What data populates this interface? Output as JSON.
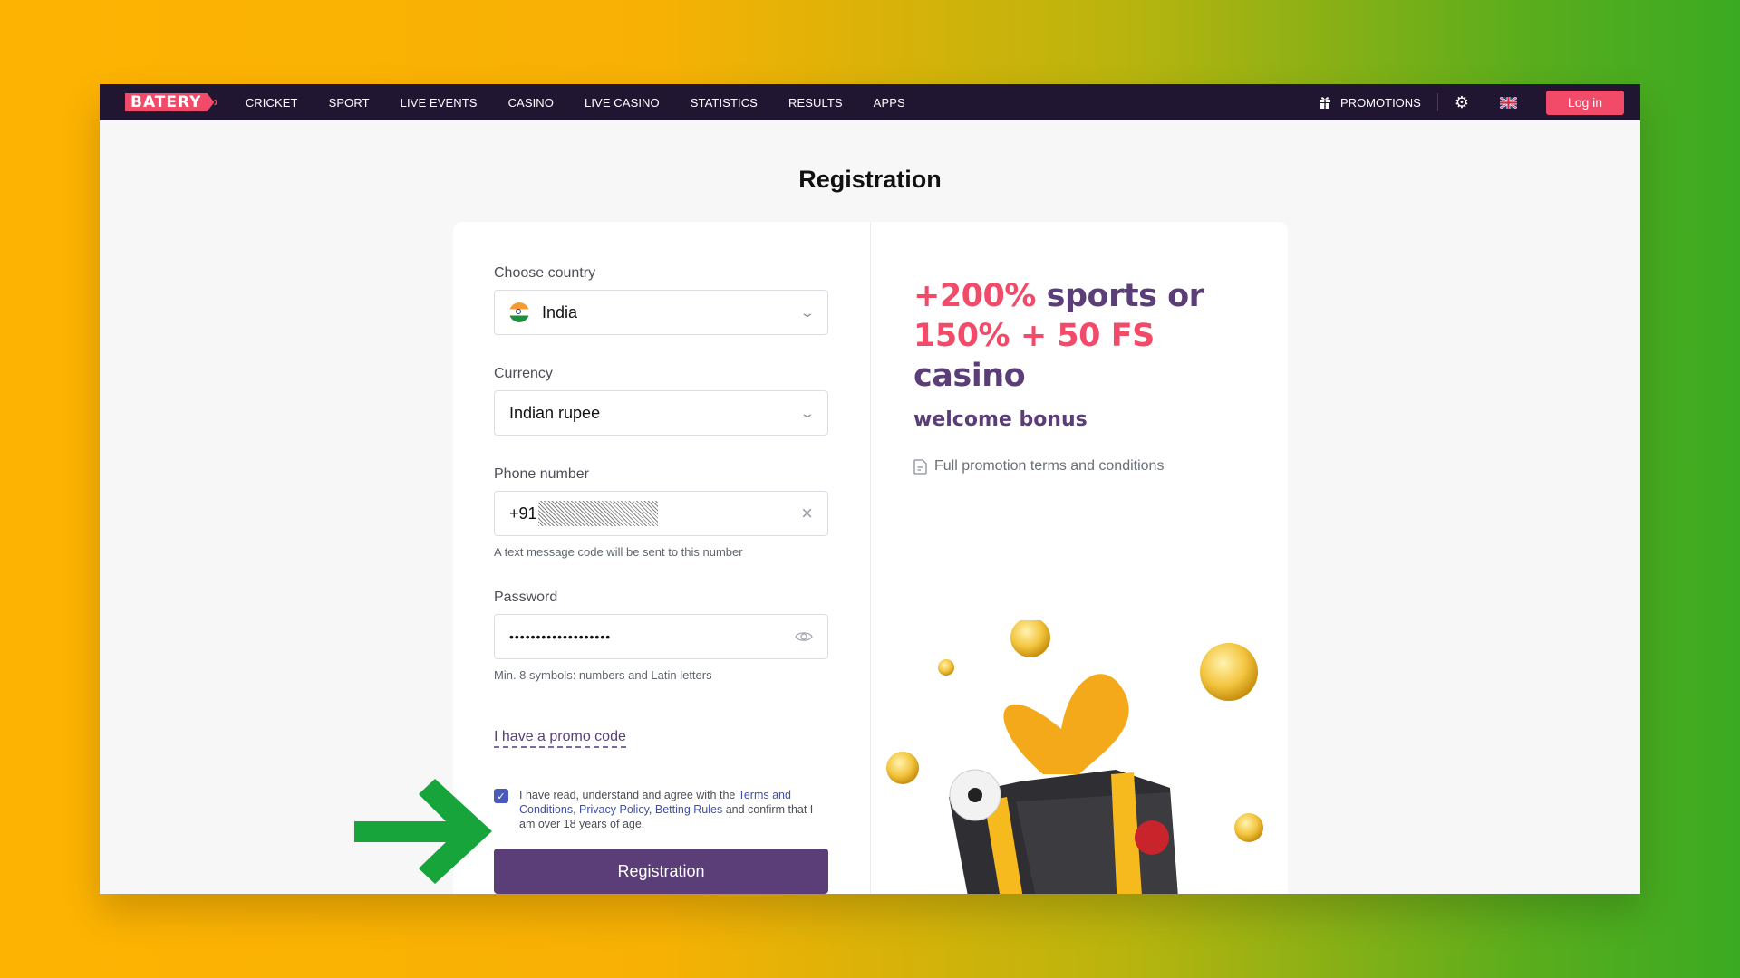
{
  "nav": {
    "logo": "BATERY",
    "links": [
      "CRICKET",
      "SPORT",
      "LIVE EVENTS",
      "CASINO",
      "LIVE CASINO",
      "STATISTICS",
      "RESULTS",
      "APPS"
    ],
    "promotions": "PROMOTIONS",
    "login": "Log in",
    "icons": {
      "promotions": "gift-icon",
      "settings": "gear-icon",
      "language": "uk-flag-icon"
    }
  },
  "page": {
    "title": "Registration"
  },
  "form": {
    "country": {
      "label": "Choose country",
      "value": "India",
      "icon": "india-flag-icon"
    },
    "currency": {
      "label": "Currency",
      "value": "Indian rupee"
    },
    "phone": {
      "label": "Phone number",
      "prefix": "+91",
      "hint": "A text message code will be sent to this number"
    },
    "password": {
      "label": "Password",
      "value": "•••••••••••••••••••",
      "hint": "Min. 8 symbols: numbers and Latin letters"
    },
    "promo_link": "I have a promo code",
    "agreement": {
      "checked": true,
      "text_before": "I have read, understand and agree with the ",
      "terms": "Terms and Conditions",
      "sep1": ", ",
      "privacy": "Privacy Policy",
      "sep2": ", ",
      "betting": "Betting Rules",
      "text_after": " and confirm that I am over 18 years of age."
    },
    "submit": "Registration"
  },
  "promo": {
    "line1_accent": "+200%",
    "line1_rest": " sports or",
    "line2_accent": "150% + 50 FS",
    "line2_rest": " casino",
    "subtitle": "welcome bonus",
    "terms_link": "Full promotion terms and conditions"
  },
  "colors": {
    "accent_pink": "#f24a69",
    "brand_purple": "#5b3e78",
    "nav_bg": "#211631",
    "annotation_arrow": "#17a53b"
  }
}
